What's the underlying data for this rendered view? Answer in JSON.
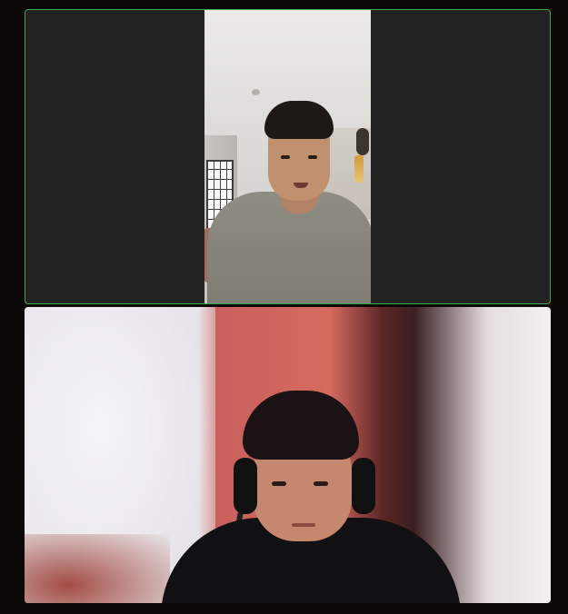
{
  "meeting": {
    "layout": "two-tile-vertical",
    "active_speaker_border_color": "#3fa84a",
    "tile_background": "#232323",
    "window_background": "#0b0808"
  },
  "participants": [
    {
      "role": "active-speaker",
      "video_on": true,
      "orientation": "portrait"
    },
    {
      "role": "participant",
      "video_on": true,
      "orientation": "landscape",
      "background": "blurred"
    }
  ]
}
